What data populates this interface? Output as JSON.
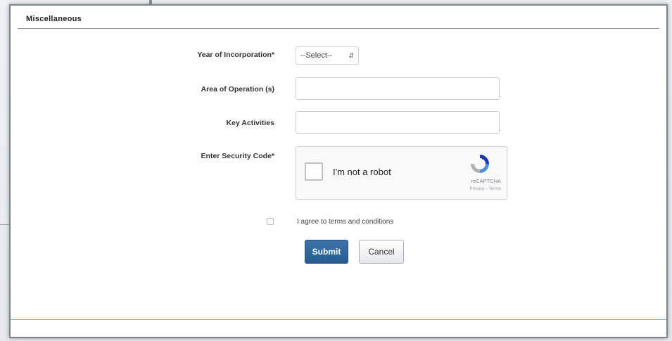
{
  "section": {
    "title": "Miscellaneous"
  },
  "form": {
    "year_label": "Year of Incorporation*",
    "year_select_value": "--Select--",
    "area_label": "Area of Operation (s)",
    "area_value": "",
    "key_label": "Key Activities",
    "key_value": "",
    "security_label": "Enter Security Code*"
  },
  "recaptcha": {
    "label": "I'm not a robot",
    "brand": "reCAPTCHA",
    "links": "Privacy - Terms"
  },
  "terms": {
    "label": "I agree to terms and conditions",
    "checked": false
  },
  "actions": {
    "submit_label": "Submit",
    "cancel_label": "Cancel"
  },
  "colors": {
    "primary": "#245d93",
    "footer_accent": "#7fb2df"
  },
  "icons": {
    "select_arrow": "up-down-arrows-icon",
    "recaptcha_logo": "recaptcha-logo-icon"
  }
}
